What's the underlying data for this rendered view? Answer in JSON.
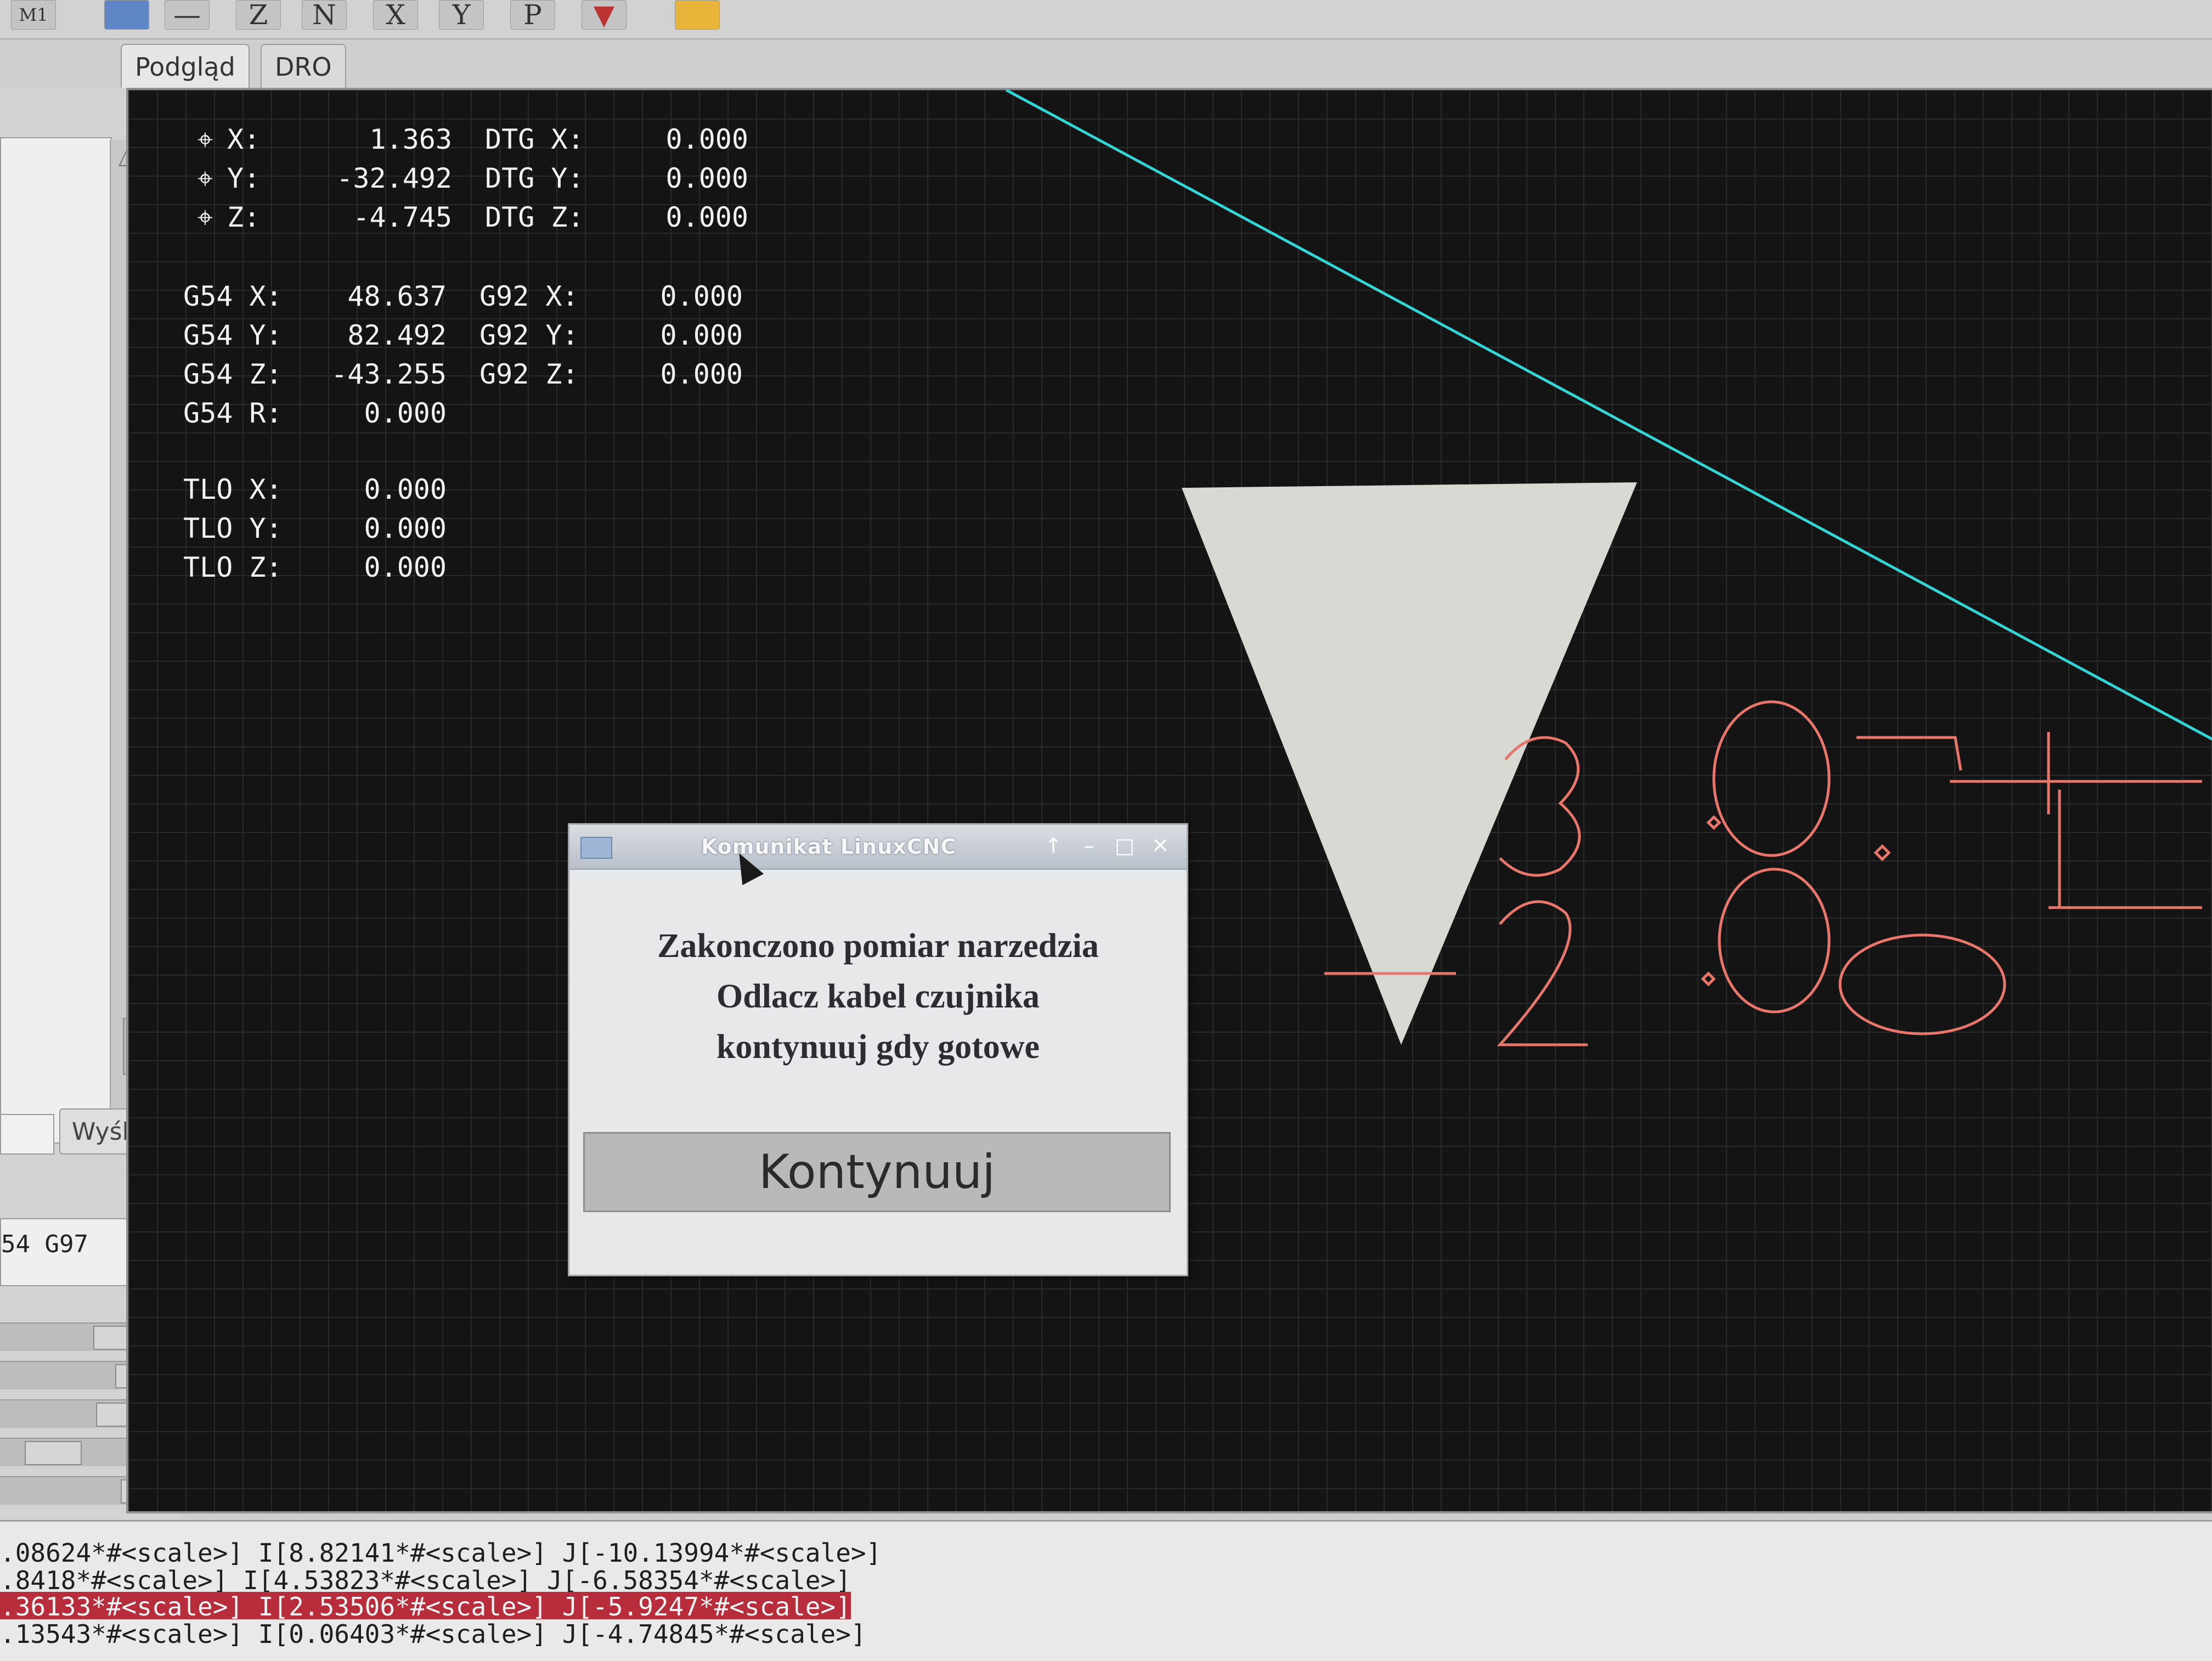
{
  "toolbar": {
    "buttons": [
      {
        "icon": "m1-icon",
        "label": "M1"
      },
      {
        "icon": "blue-arrow-icon",
        "label": ""
      },
      {
        "icon": "minus-icon",
        "label": ""
      },
      {
        "icon": "view-z-icon",
        "label": "Z"
      },
      {
        "icon": "view-n-icon",
        "label": "N"
      },
      {
        "icon": "view-x-icon",
        "label": "X"
      },
      {
        "icon": "view-y-icon",
        "label": "Y"
      },
      {
        "icon": "view-p-icon",
        "label": "P"
      },
      {
        "icon": "cone-icon",
        "label": ""
      },
      {
        "icon": "folder-icon",
        "label": ""
      }
    ]
  },
  "tabs": [
    {
      "label": "Podgląd",
      "active": true
    },
    {
      "label": "DRO",
      "active": false
    }
  ],
  "left_panel": {
    "send_label": "Wyślij",
    "modal_text": "54 G97"
  },
  "dro": {
    "position": [
      {
        "axis": "X:",
        "value": "1.363",
        "dtg_label": "DTG X:",
        "dtg_value": "0.000"
      },
      {
        "axis": "Y:",
        "value": "-32.492",
        "dtg_label": "DTG Y:",
        "dtg_value": "0.000"
      },
      {
        "axis": "Z:",
        "value": "-4.745",
        "dtg_label": "DTG Z:",
        "dtg_value": "0.000"
      }
    ],
    "offsets": [
      {
        "label": "G54 X:",
        "value": "48.637",
        "g92_label": "G92 X:",
        "g92_value": "0.000"
      },
      {
        "label": "G54 Y:",
        "value": "82.492",
        "g92_label": "G92 Y:",
        "g92_value": "0.000"
      },
      {
        "label": "G54 Z:",
        "value": "-43.255",
        "g92_label": "G92 Z:",
        "g92_value": "0.000"
      },
      {
        "label": "G54 R:",
        "value": "0.000"
      }
    ],
    "tlo": [
      {
        "label": "TLO X:",
        "value": "0.000"
      },
      {
        "label": "TLO Y:",
        "value": "0.000"
      },
      {
        "label": "TLO Z:",
        "value": "0.000"
      }
    ]
  },
  "preview": {
    "toolpath_text": [
      "3.0",
      "2.0"
    ],
    "colors": {
      "grid": "#2a2a2a",
      "limit_line": "#33d6d6",
      "toolpath": "#e8766a",
      "tool": "#d9d9d4"
    }
  },
  "dialog": {
    "title": "Komunikat LinuxCNC",
    "message": [
      "Zakonczono pomiar narzedzia",
      "Odlacz kabel czujnika",
      "kontynuuj gdy gotowe"
    ],
    "button_label": "Kontynuuj"
  },
  "gcode": {
    "lines": [
      {
        "text": ".08624*#<scale>] I[8.82141*#<scale>] J[-10.13994*#<scale>]",
        "highlight": false
      },
      {
        "text": ".8418*#<scale>] I[4.53823*#<scale>] J[-6.58354*#<scale>]",
        "highlight": false
      },
      {
        "text": ".36133*#<scale>] I[2.53506*#<scale>] J[-5.9247*#<scale>]",
        "highlight": true
      },
      {
        "text": ".13543*#<scale>] I[0.06403*#<scale>] J[-4.74845*#<scale>]",
        "highlight": false
      }
    ]
  }
}
